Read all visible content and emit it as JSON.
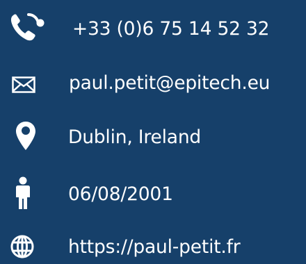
{
  "contacts": {
    "phone": {
      "icon": "phone-icon",
      "text": "+33 (0)6 75 14 52 32"
    },
    "email": {
      "icon": "envelope-icon",
      "text": "paul.petit@epitech.eu"
    },
    "location": {
      "icon": "map-pin-icon",
      "text": "Dublin, Ireland"
    },
    "birthdate": {
      "icon": "person-icon",
      "text": "06/08/2001"
    },
    "website": {
      "icon": "globe-icon",
      "text": "https://paul-petit.fr"
    }
  },
  "colors": {
    "background": "#16406a",
    "text": "#ffffff"
  }
}
